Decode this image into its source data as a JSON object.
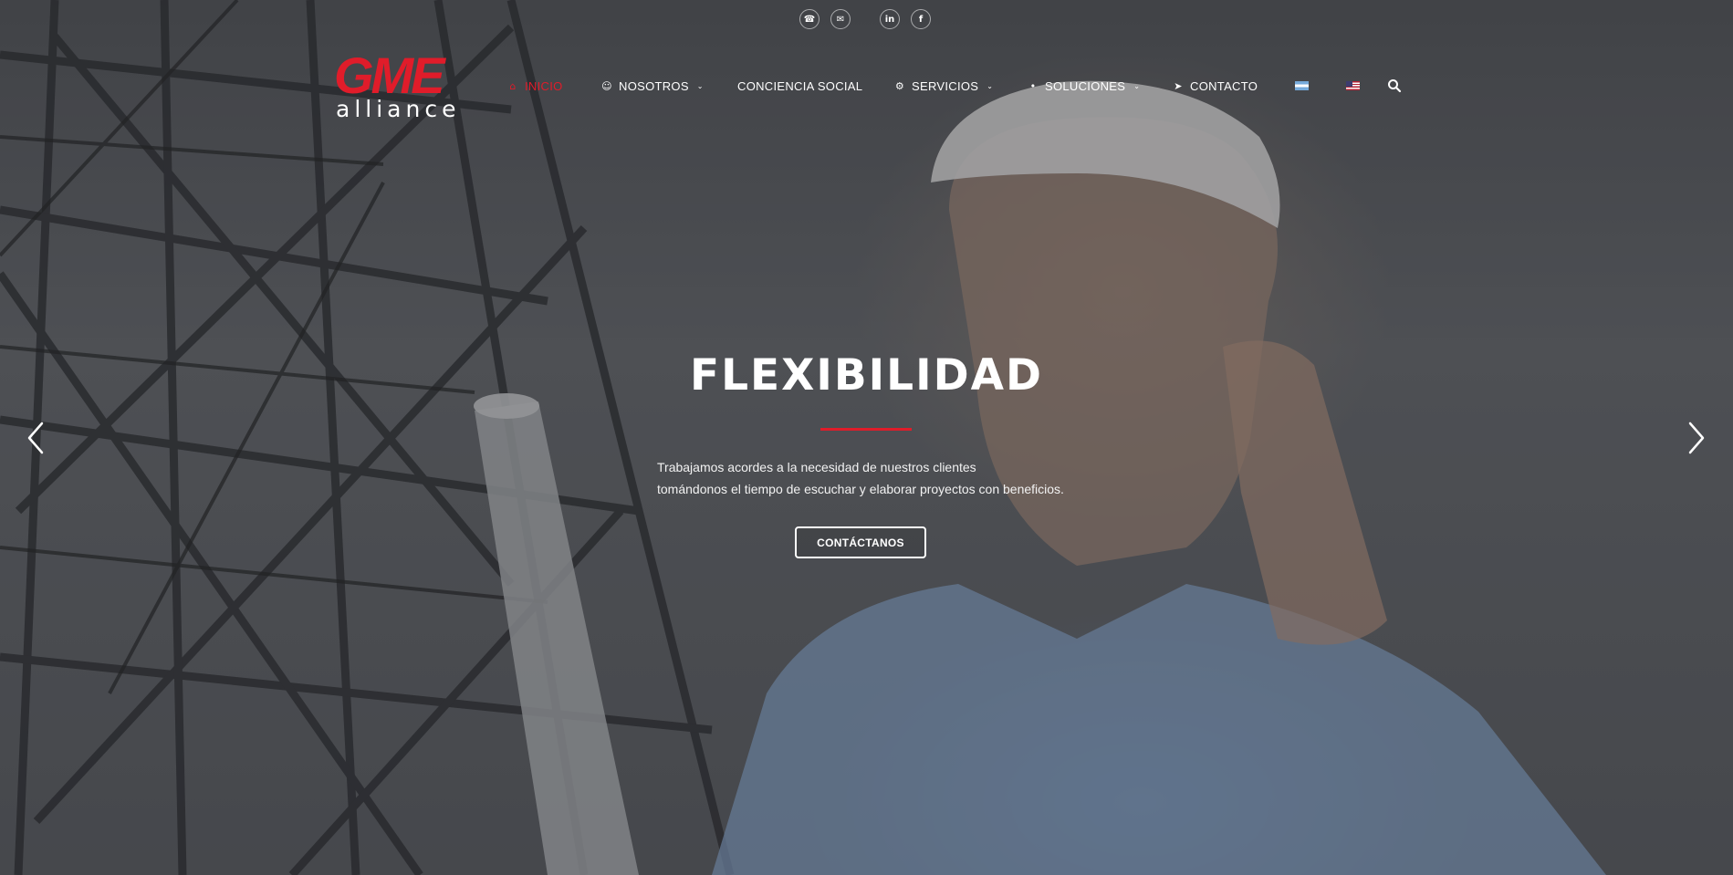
{
  "topbar": {
    "social": [
      {
        "icon": "phone-icon",
        "glyph": "☎"
      },
      {
        "icon": "mail-icon",
        "glyph": "✉"
      },
      {
        "icon": "linkedin-icon",
        "glyph": "in"
      },
      {
        "icon": "facebook-icon",
        "glyph": "f"
      }
    ]
  },
  "logo": {
    "primary": "GME",
    "secondary": "alliance"
  },
  "nav": {
    "items": [
      {
        "label": "INICIO",
        "icon": "home-icon",
        "glyph": "⌂",
        "active": true,
        "dropdown": false
      },
      {
        "label": "NOSOTROS",
        "icon": "user-icon",
        "glyph": "☺",
        "active": false,
        "dropdown": true
      },
      {
        "label": "CONCIENCIA SOCIAL",
        "icon": "",
        "glyph": "",
        "active": false,
        "dropdown": false
      },
      {
        "label": "SERVICIOS",
        "icon": "gears-icon",
        "glyph": "⚙",
        "active": false,
        "dropdown": true
      },
      {
        "label": "SOLUCIONES",
        "icon": "lightbulb-icon",
        "glyph": "•",
        "active": false,
        "dropdown": true
      },
      {
        "label": "CONTACTO",
        "icon": "paper-plane-icon",
        "glyph": "➤",
        "active": false,
        "dropdown": false
      }
    ],
    "languages": [
      {
        "name": "flag-argentina-icon"
      },
      {
        "name": "flag-usa-icon"
      }
    ],
    "search_icon": "search-icon"
  },
  "hero": {
    "title": "FLEXIBILIDAD",
    "text_line1": "Trabajamos acordes a la necesidad de nuestros clientes",
    "text_line2": "tomándonos el tiempo de escuchar y elaborar proyectos con beneficios.",
    "cta_label": "CONTÁCTANOS",
    "prev_icon": "chevron-left-icon",
    "next_icon": "chevron-right-icon"
  },
  "colors": {
    "accent": "#e01c2a",
    "text": "#ffffff"
  }
}
